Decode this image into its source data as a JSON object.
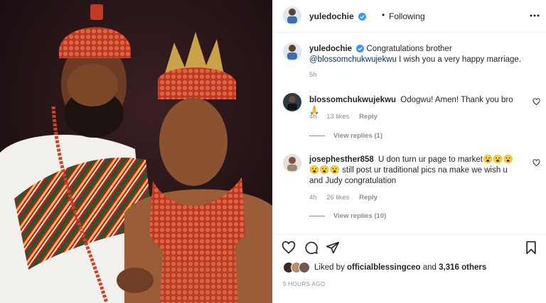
{
  "post": {
    "author": "yuledochie",
    "follow_dot": "•",
    "follow_status": "Following",
    "more_icon": "more-horizontal-icon"
  },
  "caption": {
    "author": "yuledochie",
    "text_before": "Congratulations brother ",
    "mention": "@blossomchukwujekwu",
    "text_after": " I wish you a very happy marriage.",
    "time": "5h"
  },
  "comments": [
    {
      "author": "blossomchukwujekwu",
      "text": "Odogwu! Amen! Thank you bro🙏",
      "time": "4h",
      "likes": "13 likes",
      "reply_label": "Reply",
      "view_replies": "View replies (1)"
    },
    {
      "author": "josephesther858",
      "text": "U don turn ur page to market😮😮😮😮😮😮 still post ur traditional pics na make we wish u and Judy congratulation",
      "time": "4h",
      "likes": "26 likes",
      "reply_label": "Reply",
      "view_replies": "View replies (10)"
    }
  ],
  "liked_by": {
    "prefix": "Liked by ",
    "user": "officialblessingceo",
    "suffix": " and ",
    "others": "3,316 others"
  },
  "post_time": "5 HOURS AGO",
  "colors": {
    "verified": "#3897f0",
    "mention": "#00376b",
    "muted": "#8e8e8e",
    "coral": "#c9442b"
  }
}
